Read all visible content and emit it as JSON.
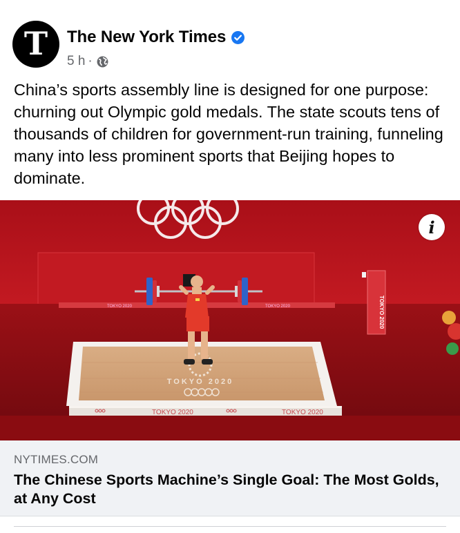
{
  "post": {
    "author": {
      "name": "The New York Times",
      "avatar_letter": "T",
      "verified_icon": "verified-badge-icon"
    },
    "meta": {
      "time": "5 h",
      "separator": "·",
      "audience_icon": "globe-icon"
    },
    "text": "China’s sports assembly line is designed for one purpose: churning out Olympic gold medals. The state scouts tens of thousands of children for government-run training, funneling many into less prominent sports that Beijing hopes to dominate.",
    "media": {
      "info_glyph": "i",
      "sign_labels": [
        "TOKYO 2020",
        "TOKYO 2020",
        "TOKYO 2020",
        "TOKYO 2020",
        "TOKYO 2020",
        "TOKYO 2020"
      ],
      "podium_logo": "TOKYO 2020"
    },
    "link": {
      "domain": "NYTIMES.COM",
      "title": "The Chinese Sports Machine’s Single Goal: The Most Golds, at Any Cost"
    }
  },
  "colors": {
    "brand_blue": "#1877f2",
    "secondary_text": "#65676b",
    "card_background": "#f0f2f5",
    "venue_red": "#b5141a"
  }
}
